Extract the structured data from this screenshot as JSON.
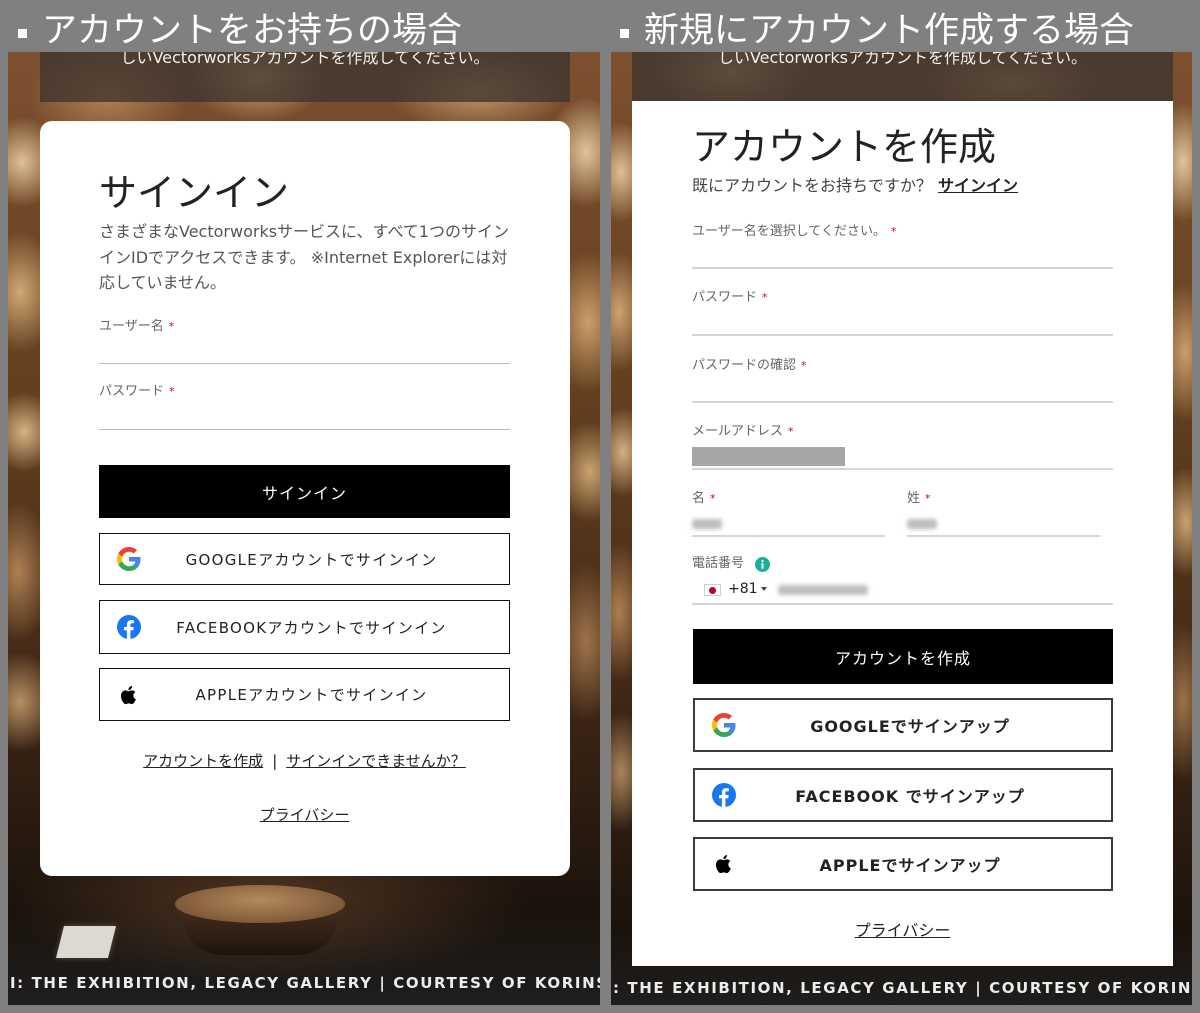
{
  "headings": {
    "existing_account": "アカウントをお持ちの場合",
    "new_account": "新規にアカウント作成する場合"
  },
  "background": {
    "banner_text": "しいVectorworksアカウントを作成してください。",
    "caption_left": "I: THE EXHIBITION, LEGACY GALLERY | COURTESY OF KORINS AND DRE",
    "caption_right": ": THE EXHIBITION, LEGACY GALLERY | COURTESY OF KORINS AND DRE"
  },
  "signin": {
    "title": "サインイン",
    "description": "さまざまなVectorworksサービスに、すべて1つのサインインIDでアクセスできます。 ※Internet Explorerには対応していません。",
    "username_label": "ユーザー名",
    "password_label": "パスワード",
    "required_mark": "*",
    "submit_label": "サインイン",
    "social_buttons": [
      {
        "label": "GOOGLEアカウントでサインイン",
        "icon": "google-icon"
      },
      {
        "label": "FACEBOOKアカウントでサインイン",
        "icon": "facebook-icon"
      },
      {
        "label": "APPLEアカウントでサインイン",
        "icon": "apple-icon"
      }
    ],
    "create_account_link": "アカウントを作成",
    "separator": "|",
    "cant_sign_in_link": "サインインできませんか？",
    "privacy_link": "プライバシー"
  },
  "signup": {
    "title": "アカウントを作成",
    "have_account_text": "既にアカウントをお持ちですか？",
    "signin_link": "サインイン",
    "required_mark": "*",
    "fields": {
      "username_label": "ユーザー名を選択してください。",
      "password_label": "パスワード",
      "password_confirm_label": "パスワードの確認",
      "email_label": "メールアドレス",
      "first_name_label": "名",
      "last_name_label": "姓",
      "phone_label": "電話番号",
      "phone_country_code": "+81"
    },
    "submit_label": "アカウントを作成",
    "social_buttons": [
      {
        "label": "GOOGLEでサインアップ",
        "icon": "google-icon"
      },
      {
        "label": "FACEBOOK でサインアップ",
        "icon": "facebook-icon"
      },
      {
        "label": "APPLEでサインアップ",
        "icon": "apple-icon"
      }
    ],
    "privacy_link": "プライバシー"
  },
  "icons": {
    "heading_bullet": "square-bullet-icon",
    "phone_info": "info-icon",
    "phone_country": "japan-flag-icon",
    "phone_dropdown": "chevron-down-icon"
  },
  "colors": {
    "page_background": "#808080",
    "card": "#ffffff",
    "primary_button": "#000000",
    "required_mark": "#d0021b",
    "info_icon": "#17b29a",
    "facebook": "#1877f2"
  }
}
